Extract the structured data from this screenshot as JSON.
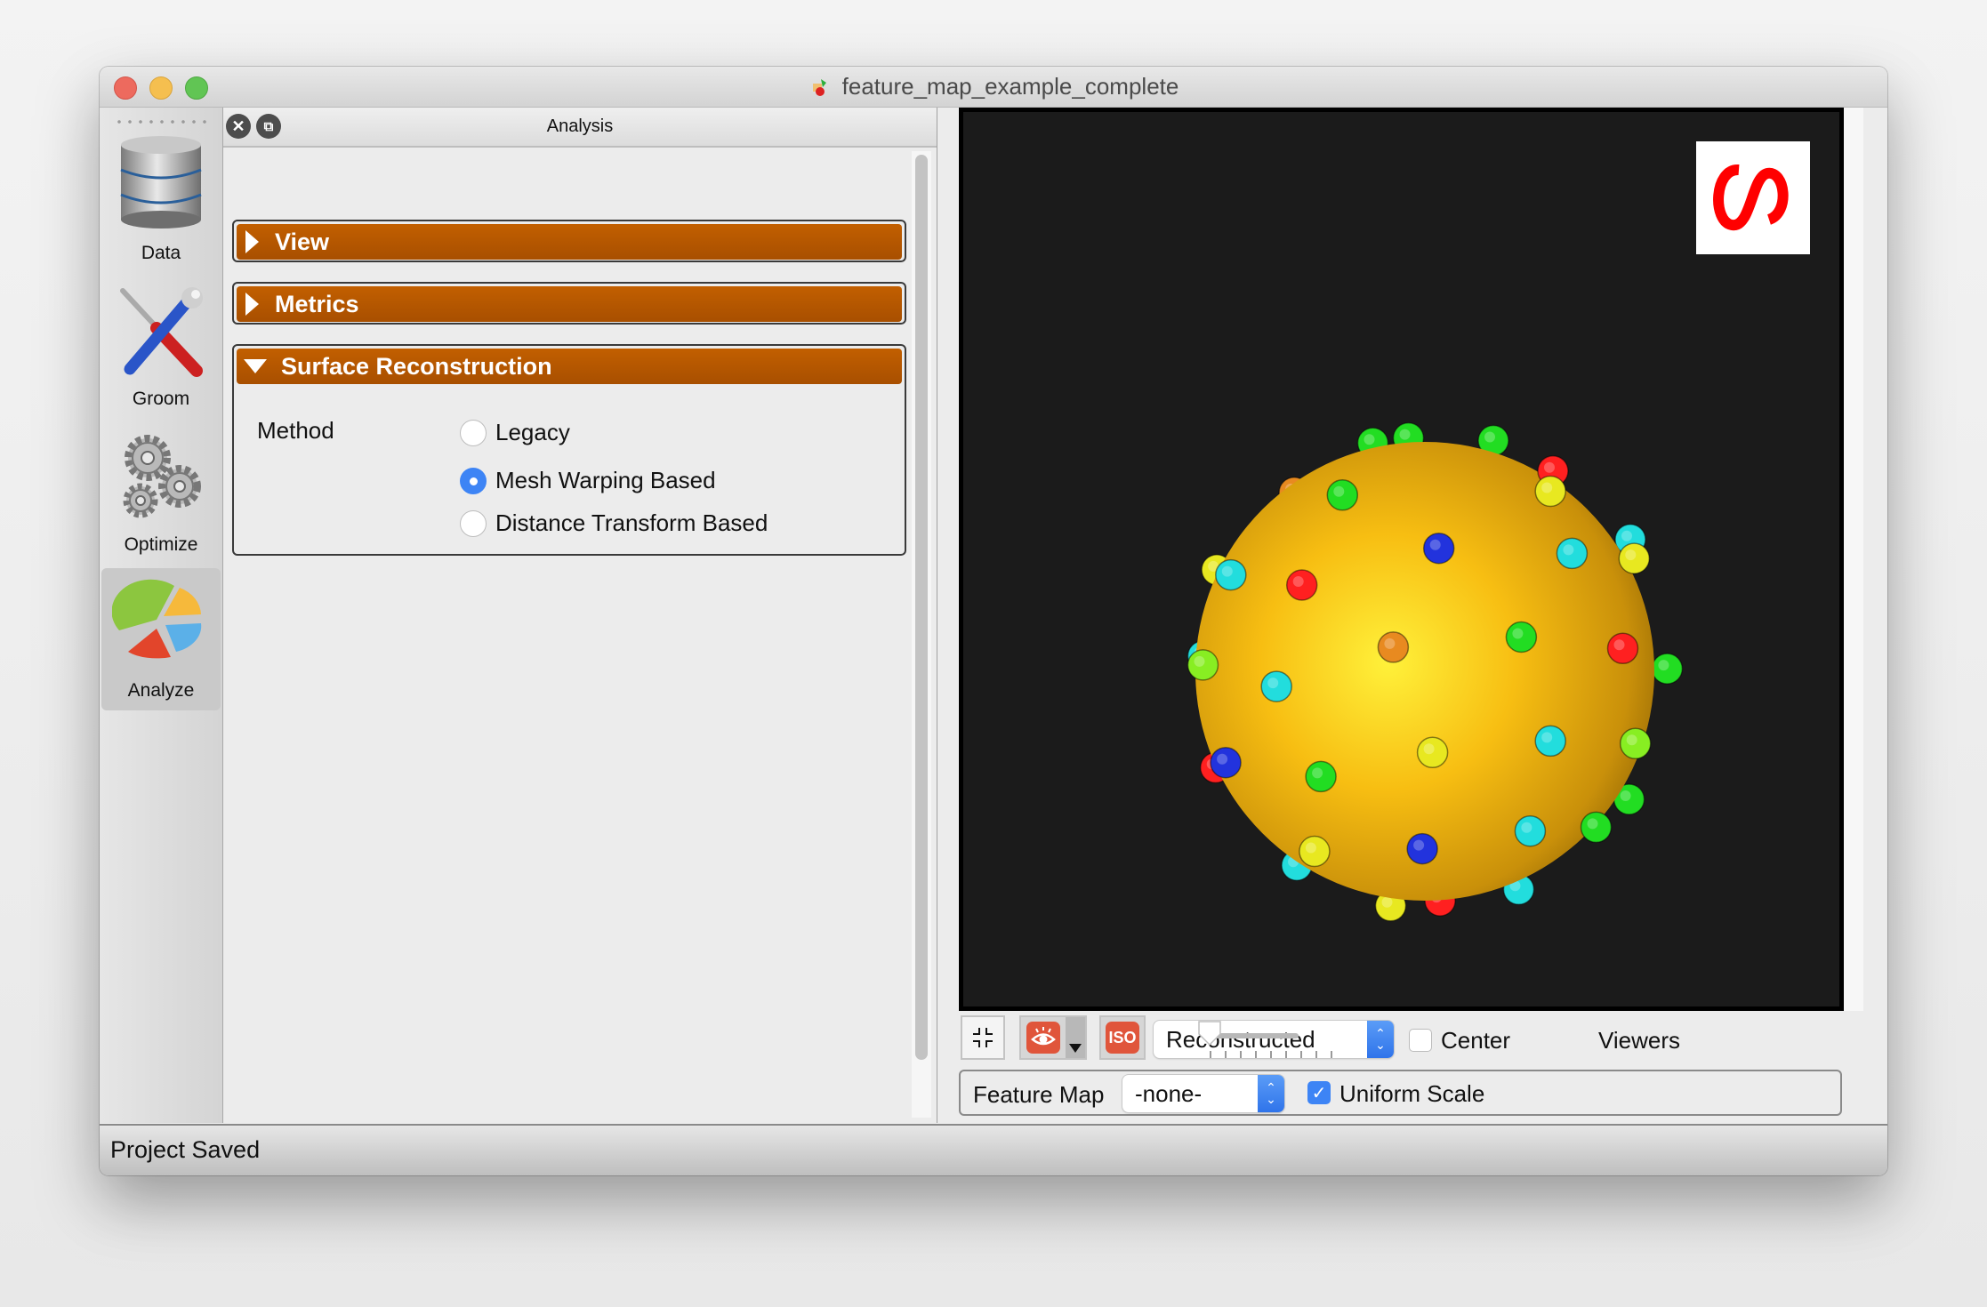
{
  "window": {
    "title": "feature_map_example_complete",
    "app_icon": "shapeworks-app-icon"
  },
  "sidebar": {
    "items": [
      {
        "label": "Data",
        "icon": "database-icon",
        "active": false
      },
      {
        "label": "Groom",
        "icon": "tools-icon",
        "active": false
      },
      {
        "label": "Optimize",
        "icon": "gears-icon",
        "active": false
      },
      {
        "label": "Analyze",
        "icon": "pie-chart-icon",
        "active": true
      }
    ]
  },
  "analysis_panel": {
    "title": "Analysis",
    "dock_buttons": [
      "close-icon",
      "float-icon"
    ],
    "sections": [
      {
        "label": "View",
        "expanded": false
      },
      {
        "label": "Metrics",
        "expanded": false
      },
      {
        "label": "Surface Reconstruction",
        "expanded": true
      }
    ],
    "surface_reconstruction": {
      "method_label": "Method",
      "options": [
        {
          "label": "Legacy",
          "selected": false
        },
        {
          "label": "Mesh Warping Based",
          "selected": true
        },
        {
          "label": "Distance Transform Based",
          "selected": false
        }
      ]
    }
  },
  "viewer": {
    "background": "#1b1b1b",
    "shape_color": "#f2b705",
    "logo_color": "#ff0000",
    "particle_colors": [
      "#ff2020",
      "#22dd22",
      "#22dddd",
      "#2233dd",
      "#e8e820",
      "#e88a20",
      "#88ee22"
    ]
  },
  "toolbar": {
    "autoview_icon": "compress-arrows-icon",
    "glyph_toggle_icon": "eye-glyph-icon",
    "iso_label": "ISO",
    "display_mode": {
      "selected": "Reconstructed"
    },
    "center": {
      "label": "Center",
      "checked": false
    },
    "viewers": {
      "label": "Viewers",
      "value": 1,
      "min": 1,
      "max": 9
    }
  },
  "feature_map_row": {
    "label": "Feature Map",
    "selected": "-none-",
    "uniform_scale": {
      "label": "Uniform Scale",
      "checked": true
    }
  },
  "status_bar": {
    "message": "Project Saved"
  }
}
